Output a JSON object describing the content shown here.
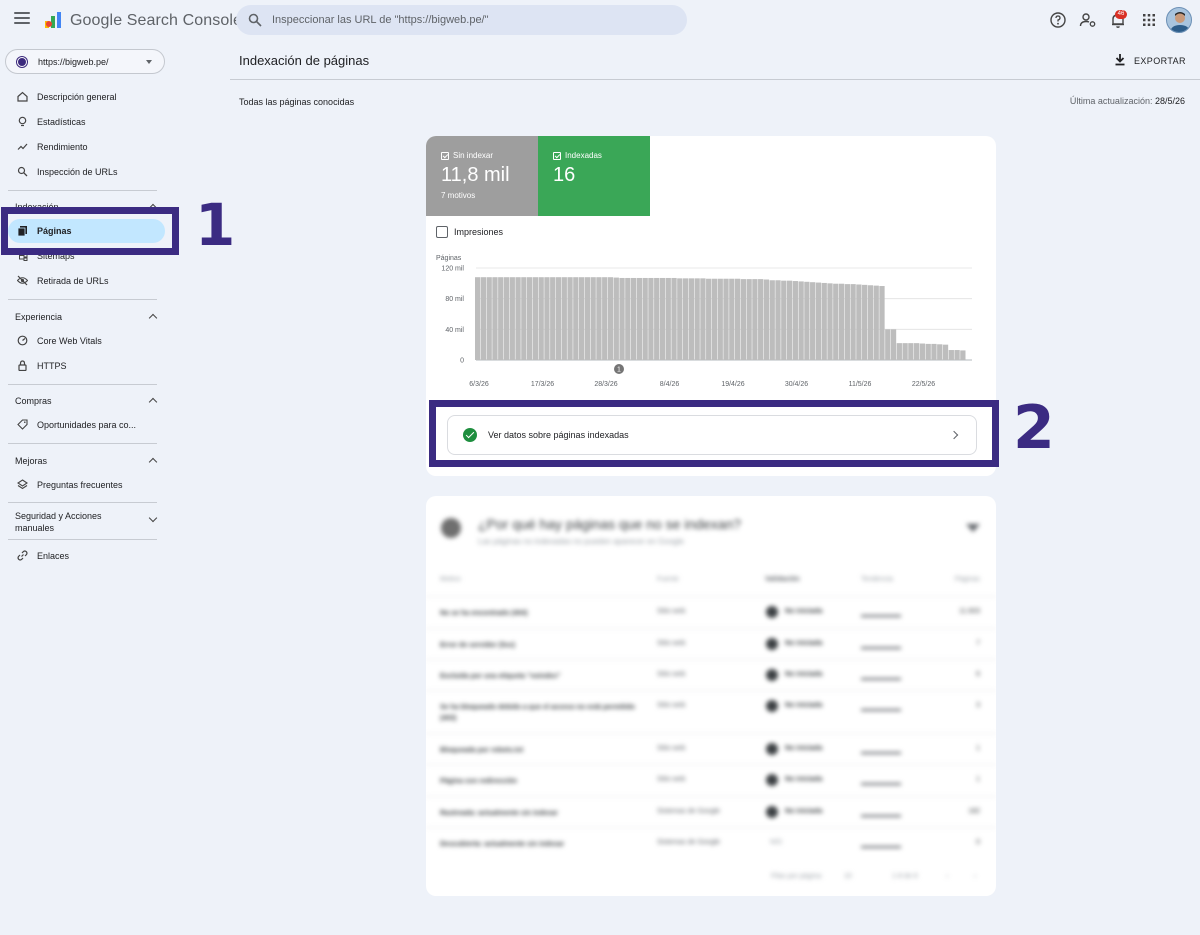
{
  "app": {
    "name": "Google Search Console"
  },
  "search": {
    "placeholder": "Inspeccionar las URL de \"https://bigweb.pe/\""
  },
  "topbar": {
    "notifications_count": "46"
  },
  "property": {
    "label": "https://bigweb.pe/"
  },
  "sidebar": {
    "items_top": [
      {
        "label": "Descripción general",
        "icon": "home-icon"
      },
      {
        "label": "Estadísticas",
        "icon": "lightbulb-icon"
      },
      {
        "label": "Rendimiento",
        "icon": "trend-icon"
      },
      {
        "label": "Inspección de URLs",
        "icon": "search-icon"
      }
    ],
    "sections": {
      "indexacion": {
        "title": "Indexación",
        "items": [
          {
            "label": "Páginas",
            "active": true
          },
          {
            "label": "Sitemaps"
          },
          {
            "label": "Retirada de URLs"
          }
        ]
      },
      "experiencia": {
        "title": "Experiencia",
        "items": [
          {
            "label": "Core Web Vitals"
          },
          {
            "label": "HTTPS"
          }
        ]
      },
      "compras": {
        "title": "Compras",
        "items": [
          {
            "label": "Oportunidades para co..."
          }
        ]
      },
      "mejoras": {
        "title": "Mejoras",
        "items": [
          {
            "label": "Preguntas frecuentes"
          }
        ]
      },
      "seguridad": {
        "title": "Seguridad y Acciones manuales"
      },
      "enlaces": {
        "label": "Enlaces"
      }
    }
  },
  "annotations": {
    "one": "1",
    "two": "2"
  },
  "header": {
    "title": "Indexación de páginas",
    "export_label": "EXPORTAR",
    "subtitle": "Todas las páginas conocidas",
    "updated_label": "Última actualización: ",
    "updated_value": "28/5/26"
  },
  "summary": {
    "not_indexed": {
      "label": "Sin indexar",
      "value": "11,8 mil",
      "sub": "7 motivos"
    },
    "indexed": {
      "label": "Indexadas",
      "value": "16"
    },
    "impressions_label": "Impresiones"
  },
  "chart_data": {
    "type": "bar",
    "ylabel": "Páginas",
    "y_ticks": [
      "120 mil",
      "80 mil",
      "40 mil",
      "0"
    ],
    "ylim": [
      0,
      120000
    ],
    "x_ticks": [
      "6/3/26",
      "17/3/26",
      "28/3/26",
      "8/4/26",
      "19/4/26",
      "30/4/26",
      "11/5/26",
      "22/5/26"
    ],
    "annotation_marker": "1",
    "values": [
      108000,
      108000,
      108000,
      108000,
      108000,
      108000,
      108000,
      108000,
      108000,
      108000,
      108000,
      108000,
      108000,
      108000,
      108000,
      108000,
      108000,
      108000,
      108000,
      108000,
      108000,
      108000,
      108000,
      108000,
      107500,
      107000,
      107000,
      107000,
      107000,
      107000,
      107000,
      107000,
      107000,
      107000,
      107000,
      106500,
      106500,
      106500,
      106500,
      106500,
      106000,
      106000,
      106000,
      106000,
      106000,
      106000,
      105500,
      105500,
      105500,
      105500,
      105000,
      104000,
      104000,
      103500,
      103500,
      103000,
      102500,
      102000,
      101500,
      101000,
      100500,
      100000,
      99500,
      99500,
      99000,
      99000,
      98500,
      98000,
      97500,
      97000,
      96500,
      40000,
      40000,
      22000,
      22000,
      22000,
      22000,
      21500,
      21000,
      21000,
      20500,
      20000,
      13000,
      13000,
      12500
    ]
  },
  "link_card": {
    "label": "Ver datos sobre páginas indexadas"
  },
  "reasons_card": {
    "title": "¿Por qué hay páginas que no se indexan?",
    "subtitle": "Las páginas no indexadas no pueden aparecer en Google",
    "columns": [
      "Motivo",
      "Fuente",
      "Validación",
      "Tendencia",
      "Páginas"
    ],
    "rows": [
      {
        "motivo": "No se ha encontrado (404)",
        "fuente": "Sitio web",
        "validacion": "No iniciada",
        "paginas": "11.603"
      },
      {
        "motivo": "Error de servidor (5xx)",
        "fuente": "Sitio web",
        "validacion": "No iniciada",
        "paginas": "7"
      },
      {
        "motivo": "Excluida por una etiqueta \"noindex\"",
        "fuente": "Sitio web",
        "validacion": "No iniciada",
        "paginas": "6"
      },
      {
        "motivo": "Se ha bloqueado debido a que el acceso no está permitido (403)",
        "fuente": "Sitio web",
        "validacion": "No iniciada",
        "paginas": "3"
      },
      {
        "motivo": "Bloqueada por robots.txt",
        "fuente": "Sitio web",
        "validacion": "No iniciada",
        "paginas": "1"
      },
      {
        "motivo": "Página con redirección",
        "fuente": "Sitio web",
        "validacion": "No iniciada",
        "paginas": "1"
      },
      {
        "motivo": "Rastreada: actualmente sin indexar",
        "fuente": "Sistemas de Google",
        "validacion": "No iniciada",
        "paginas": "182"
      },
      {
        "motivo": "Descubierta: actualmente sin indexar",
        "fuente": "Sistemas de Google",
        "validacion": "N/D",
        "paginas": "0"
      }
    ],
    "footer": {
      "rows_per_page_label": "Filas por página:",
      "rows_per_page": "10",
      "range": "1-8 de 8"
    }
  }
}
